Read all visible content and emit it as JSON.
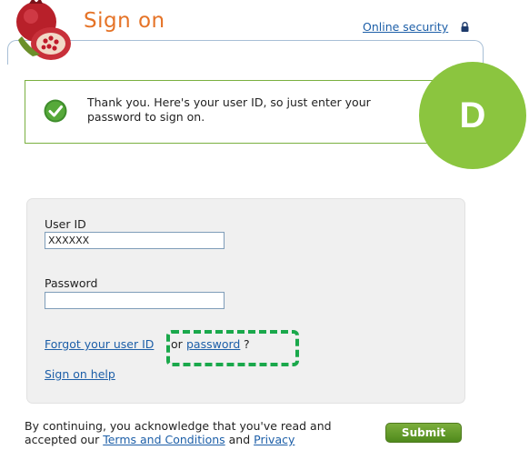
{
  "header": {
    "title": "Sign on",
    "security_link": "Online security"
  },
  "notice": {
    "text": "Thank you. Here's your user ID, so just enter your password to sign on."
  },
  "badge": {
    "letter": "D"
  },
  "form": {
    "user_id_label": "User ID",
    "user_id_value": "XXXXXX",
    "password_label": "Password",
    "password_value": "",
    "forgot_user_id": "Forgot your user ID",
    "or_text": " or ",
    "password_link": "password",
    "question_mark": "?",
    "sign_on_help": "Sign on help"
  },
  "footer": {
    "text_before": "By continuing, you acknowledge that you've read and accepted our ",
    "terms_link": "Terms and Conditions",
    "and_text": " and ",
    "privacy_link": "Privacy",
    "submit_label": "Submit"
  },
  "colors": {
    "title_orange": "#e57327",
    "link_blue": "#1d5fa8",
    "badge_green": "#8bc53f",
    "highlight_dashed_green": "#1aa84b"
  }
}
